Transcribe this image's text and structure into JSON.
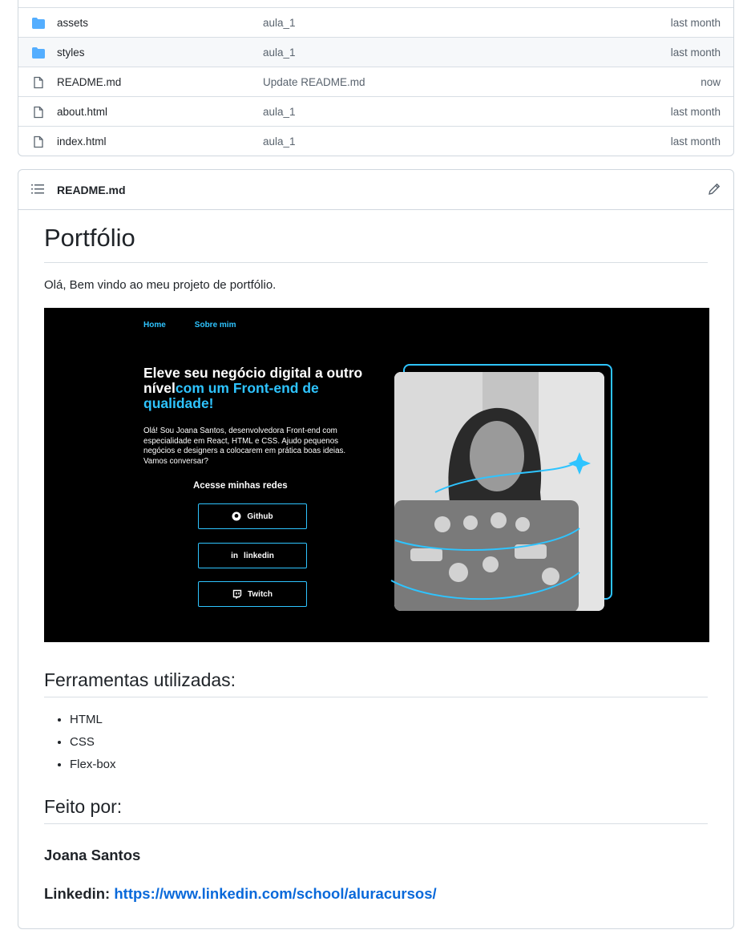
{
  "files": [
    {
      "name": "assets",
      "type": "folder",
      "message": "aula_1",
      "when": "last month"
    },
    {
      "name": "styles",
      "type": "folder",
      "message": "aula_1",
      "when": "last month"
    },
    {
      "name": "README.md",
      "type": "file",
      "message": "Update README.md",
      "when": "now"
    },
    {
      "name": "about.html",
      "type": "file",
      "message": "aula_1",
      "when": "last month"
    },
    {
      "name": "index.html",
      "type": "file",
      "message": "aula_1",
      "when": "last month"
    }
  ],
  "readme": {
    "filename": "README.md",
    "title": "Portfólio",
    "intro": "Olá, Bem vindo ao meu projeto de portfólio.",
    "screenshot": {
      "nav": [
        "Home",
        "Sobre mim"
      ],
      "headline_white": "Eleve seu negócio digital a outro nível",
      "headline_cyan": "com um Front-end de qualidade!",
      "text": "Olá! Sou Joana Santos, desenvolvedora Front-end com especialidade em React, HTML e CSS. Ajudo pequenos negócios e designers a colocarem em prática boas ideias. Vamos conversar?",
      "social_title": "Acesse minhas redes",
      "buttons": [
        "Github",
        "linkedin",
        "Twitch"
      ]
    },
    "tools_heading": "Ferramentas utilizadas:",
    "tools": [
      "HTML",
      "CSS",
      "Flex-box"
    ],
    "made_by_heading": "Feito por:",
    "author": "Joana Santos",
    "linkedin_label": "Linkedin:",
    "linkedin_url": "https://www.linkedin.com/school/aluracursos/"
  },
  "colors": {
    "folder": "#54aeff",
    "link": "#0969da",
    "accent": "#2ec4ff",
    "border": "#d0d7de"
  }
}
